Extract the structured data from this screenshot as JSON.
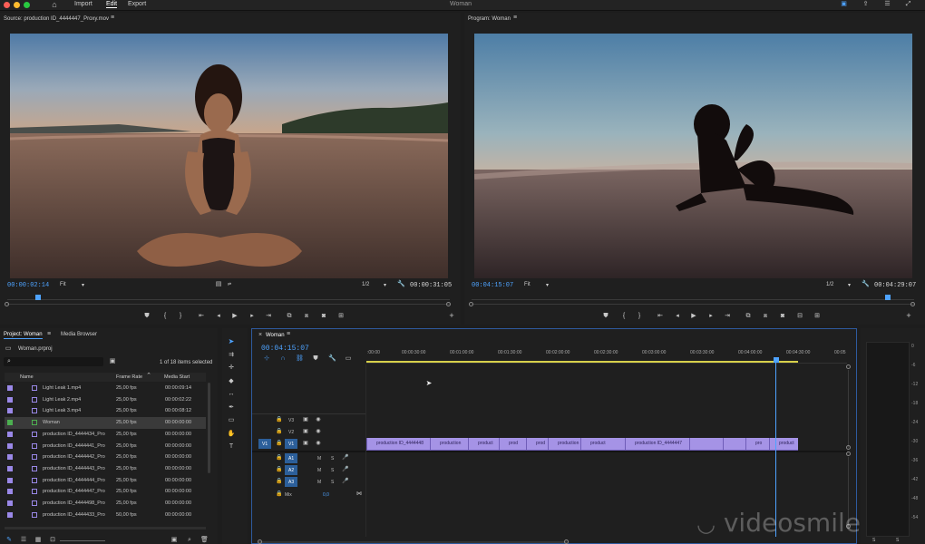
{
  "menu": {
    "import": "Import",
    "edit": "Edit",
    "export": "Export",
    "doc_title": "Woman"
  },
  "source": {
    "title": "Source: production ID_4444447_Proxy.mov",
    "timecode_left": "00:00:02:14",
    "fit": "Fit",
    "resolution": "1/2",
    "timecode_right": "00:00:31:05",
    "playhead_fraction": 0.07
  },
  "program": {
    "title": "Program: Woman",
    "timecode_left": "00:04:15:07",
    "fit": "Fit",
    "resolution": "1/2",
    "timecode_right": "00:04:29:07",
    "playhead_fraction": 0.94
  },
  "project": {
    "tab_project": "Project: Woman",
    "tab_media": "Media Browser",
    "file": "Woman.prproj",
    "items_selected": "1 of 18 items selected",
    "columns": {
      "name": "Name",
      "frame_rate": "Frame Rate",
      "media_start": "Media Start"
    },
    "rows": [
      {
        "name": "Light Leak 1.mp4",
        "fps": "25,00 fps",
        "start": "00:00:09:14",
        "color": "#9a88e8"
      },
      {
        "name": "Light Leak 2.mp4",
        "fps": "25,00 fps",
        "start": "00:00:02:22",
        "color": "#9a88e8"
      },
      {
        "name": "Light Leak 3.mp4",
        "fps": "25,00 fps",
        "start": "00:00:08:12",
        "color": "#9a88e8"
      },
      {
        "name": "Woman",
        "fps": "25,00 fps",
        "start": "00:00:00:00",
        "color": "#4caf50"
      },
      {
        "name": "production ID_4444434_Pro",
        "fps": "25,00 fps",
        "start": "00:00:00:00",
        "color": "#9a88e8"
      },
      {
        "name": "production ID_4444441_Pro",
        "fps": "25,00 fps",
        "start": "00:00:00:00",
        "color": "#9a88e8"
      },
      {
        "name": "production ID_4444442_Pro",
        "fps": "25,00 fps",
        "start": "00:00:00:00",
        "color": "#9a88e8"
      },
      {
        "name": "production ID_4444443_Pro",
        "fps": "25,00 fps",
        "start": "00:00:00:00",
        "color": "#9a88e8"
      },
      {
        "name": "production ID_4444444_Pro",
        "fps": "25,00 fps",
        "start": "00:00:00:00",
        "color": "#9a88e8"
      },
      {
        "name": "production ID_4444447_Pro",
        "fps": "25,00 fps",
        "start": "00:00:00:00",
        "color": "#9a88e8"
      },
      {
        "name": "production ID_4444498_Pro",
        "fps": "25,00 fps",
        "start": "00:00:00:00",
        "color": "#9a88e8"
      },
      {
        "name": "production ID_4444433_Pro",
        "fps": "50,00 fps",
        "start": "00:00:00:00",
        "color": "#9a88e8"
      }
    ]
  },
  "timeline": {
    "tab": "Woman",
    "timecode": "00:04:15:07",
    "ruler": [
      ":00:00",
      "00:00:30:00",
      "00:01:00:00",
      "00:01:30:00",
      "00:02:00:00",
      "00:02:30:00",
      "00:03:00:00",
      "00:03:30:00",
      "00:04:00:00",
      "00:04:30:00",
      "00:05"
    ],
    "tracks": {
      "v3": "V3",
      "v2": "V2",
      "v1": "V1",
      "v1_src": "V1",
      "a1": "A1",
      "a2": "A2",
      "a3": "A3",
      "m": "M",
      "s": "S",
      "mix": "Mix",
      "mix_value": "0,0"
    },
    "clips": [
      {
        "label": "production ID_4444448"
      },
      {
        "label": "production"
      },
      {
        "label": "product"
      },
      {
        "label": "prod"
      },
      {
        "label": "prod"
      },
      {
        "label": "production ID_44"
      },
      {
        "label": "product"
      },
      {
        "label": "production ID_4444447"
      },
      {
        "label": ""
      },
      {
        "label": ""
      },
      {
        "label": "pro"
      },
      {
        "label": "product"
      }
    ]
  },
  "meter": {
    "labels": [
      "0",
      "-6",
      "-12",
      "-18",
      "-24",
      "-30",
      "-36",
      "-42",
      "-48",
      "-54"
    ],
    "s1": "S",
    "s2": "S"
  },
  "watermark": "videosmile"
}
